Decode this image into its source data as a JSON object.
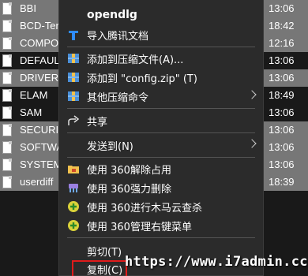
{
  "files": [
    {
      "name": "BBI",
      "time": "13:06",
      "selected": true
    },
    {
      "name": "BCD-Ter",
      "time": "18:42",
      "selected": true
    },
    {
      "name": "COMPO",
      "time": "12:16",
      "selected": true
    },
    {
      "name": "DEFAUL",
      "time": "13:06",
      "selected": false
    },
    {
      "name": "DRIVERS",
      "time": "13:06",
      "selected": true
    },
    {
      "name": "ELAM",
      "time": "18:49",
      "selected": false
    },
    {
      "name": "SAM",
      "time": "13:06",
      "selected": false
    },
    {
      "name": "SECURIT",
      "time": "13:06",
      "selected": true
    },
    {
      "name": "SOFTWA",
      "time": "13:06",
      "selected": true
    },
    {
      "name": "SYSTEM",
      "time": "13:06",
      "selected": true
    },
    {
      "name": "userdiff",
      "time": "18:39",
      "selected": true
    }
  ],
  "menu": {
    "open": "opendlg",
    "import_tencent": "导入腾讯文档",
    "add_archive": "添加到压缩文件(A)...",
    "add_zip": "添加到 \"config.zip\" (T)",
    "other_compress": "其他压缩命令",
    "share": "共享",
    "send_to": "发送到(N)",
    "unlock_360": "使用 360解除占用",
    "force_delete_360": "使用 360强力删除",
    "trojan_scan_360": "使用 360进行木马云查杀",
    "manage_menu_360": "使用 360管理右键菜单",
    "cut": "剪切(T)",
    "copy": "复制(C)"
  },
  "watermark": "https://www.i7admin.cc",
  "colors": {
    "menu_bg": "#2b2b2b",
    "selection": "#777777",
    "highlight_border": "#e01b1b"
  }
}
